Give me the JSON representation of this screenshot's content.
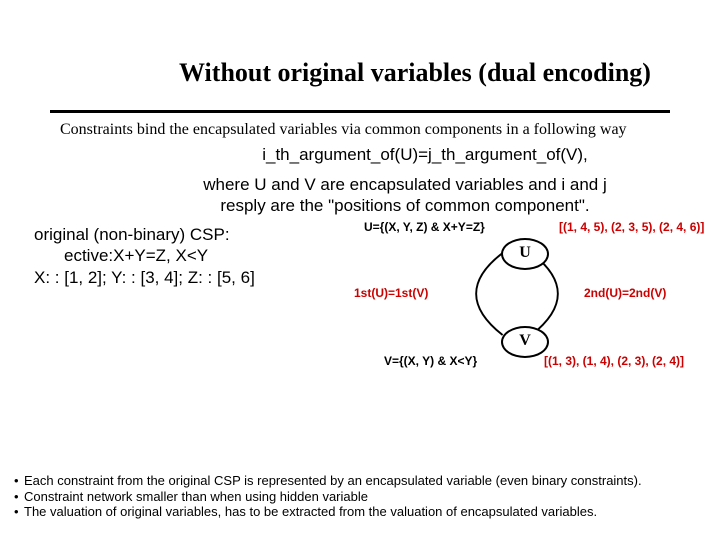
{
  "title": "Without original variables (dual encoding)",
  "intro": "Constraints bind the encapsulated variables via common components in a following way",
  "formula": "i_th_argument_of(U)=j_th_argument_of(V),",
  "explain_line1": "where U and V are encapsulated variables and i and j",
  "explain_line2": "resply are the \"positions of common component\".",
  "csp": {
    "header": "original (non-binary) CSP:",
    "line1": "ective:X+Y=Z, X<Y",
    "line2": "X: : [1, 2]; Y: : [3, 4]; Z: : [5, 6]"
  },
  "diagram": {
    "U": "U",
    "V": "V",
    "U_def": "U={(X, Y, Z) & X+Y=Z}",
    "U_tuples": "[(1, 4, 5), (2, 3, 5), (2, 4, 6)]",
    "V_def": "V={(X, Y) & X<Y}",
    "V_tuples": "[(1, 3), (1, 4), (2, 3), (2, 4)]",
    "left_constraint": "1st(U)=1st(V)",
    "right_constraint": "2nd(U)=2nd(V)"
  },
  "notes": {
    "n1": "Each constraint from the original CSP is represented by an encapsulated variable (even binary constraints).",
    "n2": "Constraint network smaller than when using hidden variable",
    "n3": "The valuation of original variables, has to be extracted from the valuation of encapsulated variables."
  }
}
